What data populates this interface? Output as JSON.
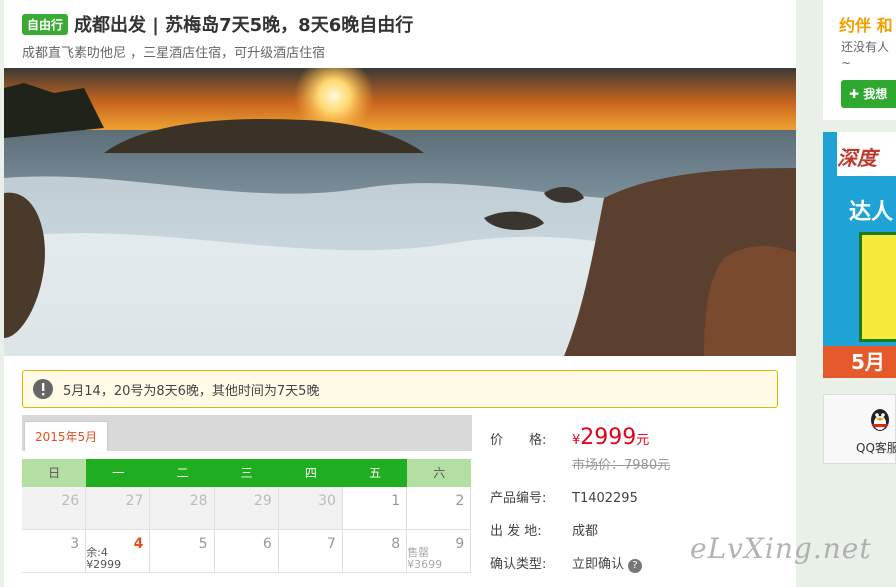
{
  "product": {
    "tag": "自由行",
    "title": "成都出发 | 苏梅岛7天5晚，8天6晚自由行",
    "subtitle": "成都直飞素叻他尼 ，三星酒店住宿，可升级酒店住宿"
  },
  "notice": {
    "text": "5月14，20号为8天6晚，其他时间为7天5晚",
    "icon": "alert-icon"
  },
  "calendar": {
    "month_tab": "2015年5月",
    "weekdays": [
      "日",
      "一",
      "二",
      "三",
      "四",
      "五",
      "六"
    ],
    "days": [
      {
        "d": "26",
        "off": true
      },
      {
        "d": "27",
        "off": true
      },
      {
        "d": "28",
        "off": true
      },
      {
        "d": "29",
        "off": true
      },
      {
        "d": "30",
        "off": true
      },
      {
        "d": "1",
        "off": false
      },
      {
        "d": "2",
        "off": false
      },
      {
        "d": "3",
        "off": false
      },
      {
        "d": "4",
        "off": false,
        "hl": true,
        "remain": "余:4",
        "price": "¥2999"
      },
      {
        "d": "5",
        "off": false
      },
      {
        "d": "6",
        "off": false
      },
      {
        "d": "7",
        "off": false
      },
      {
        "d": "8",
        "off": false
      },
      {
        "d": "9",
        "off": false,
        "soldout": "售罄",
        "price": "¥3699"
      }
    ]
  },
  "info": {
    "price_label": "价　　格:",
    "currency": "¥",
    "price": "2999",
    "price_unit": "元",
    "market_price": "市场价：7980元",
    "code_label": "产品编号:",
    "code": "T1402295",
    "from_label": "出 发 地:",
    "from": "成都",
    "confirm_label": "确认类型:",
    "confirm": "立即确认"
  },
  "sidebar": {
    "logo": "约伴 和",
    "text": "还没有人",
    "tilde": "~",
    "button": "我想",
    "ad_text_1": "深度",
    "ad_text_2": "达人",
    "ad_text_3": "5月",
    "qq_label": "QQ客服"
  },
  "watermark": "eLvXing.net",
  "colors": {
    "accent_green": "#1fae1f",
    "price_red": "#e5001f",
    "orange": "#e5501f"
  }
}
